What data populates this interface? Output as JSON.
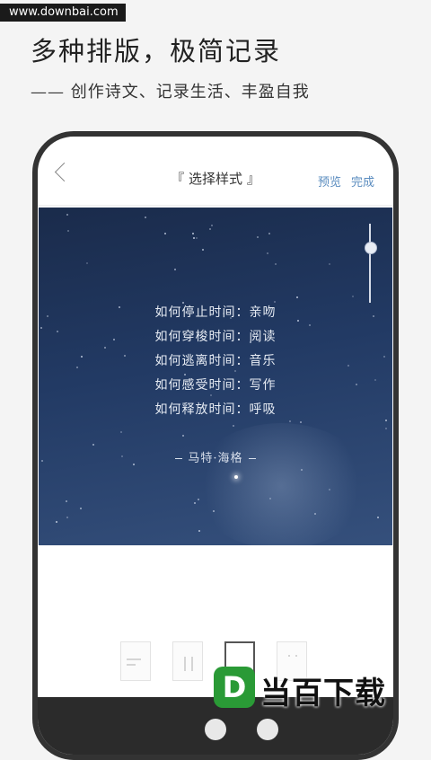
{
  "watermark": "www.downbai.com",
  "headline": "多种排版，极简记录",
  "subline": "—— 创作诗文、记录生活、丰盈自我",
  "nav": {
    "title": "『 选择样式 』",
    "preview_label": "预览",
    "done_label": "完成"
  },
  "card": {
    "poem_lines": [
      "如何停止时间：亲吻",
      "如何穿梭时间：阅读",
      "如何逃离时间：音乐",
      "如何感受时间：写作",
      "如何释放时间：呼吸"
    ],
    "author": "马特·海格",
    "slider_level": 0.3
  },
  "style_options": [
    "left-text-style",
    "two-column-style",
    "blank-style",
    "dotted-style"
  ],
  "selected_style": 2,
  "logo": {
    "badge": "D",
    "text": "当百下载",
    "color": "#2a9a36"
  }
}
